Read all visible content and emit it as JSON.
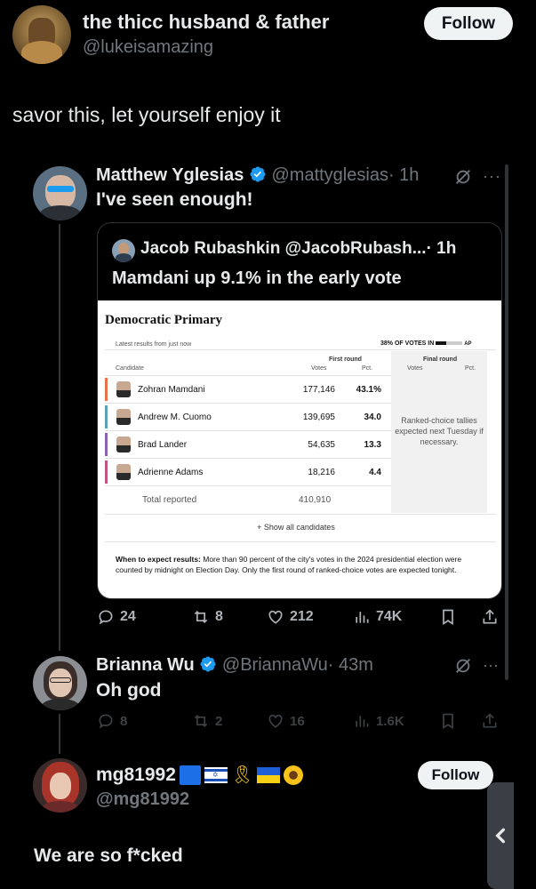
{
  "top_post": {
    "display_name": "the thicc husband & father",
    "handle": "@lukeisamazing",
    "follow_label": "Follow",
    "text": "savor this, let yourself enjoy it"
  },
  "reply1": {
    "display_name": "Matthew Yglesias",
    "handle": "@mattyglesias",
    "time": "· 1h",
    "text": "I've seen enough!",
    "quote": {
      "display_name": "Jacob Rubashkin",
      "handle": "@JacobRubash...",
      "time": "· 1h",
      "text": "Mamdani up 9.1% in the early vote"
    },
    "actions": {
      "replies": "24",
      "reposts": "8",
      "likes": "212",
      "views": "74K"
    }
  },
  "results": {
    "title": "Democratic Primary",
    "subtitle": "Latest results from just now",
    "votes_in": "38% OF VOTES IN",
    "ap": "AP",
    "first_round": "First round",
    "final_round": "Final round",
    "col_candidate": "Candidate",
    "col_votes": "Votes",
    "col_pct": "Pct.",
    "col_votes2": "Votes",
    "col_pct2": "Pct.",
    "rows": [
      {
        "name": "Zohran Mamdani",
        "votes": "177,146",
        "pct": "43.1%",
        "color": "#e8734a"
      },
      {
        "name": "Andrew M. Cuomo",
        "votes": "139,695",
        "pct": "34.0",
        "color": "#5aa3b4"
      },
      {
        "name": "Brad Lander",
        "votes": "54,635",
        "pct": "13.3",
        "color": "#8a63b8"
      },
      {
        "name": "Adrienne Adams",
        "votes": "18,216",
        "pct": "4.4",
        "color": "#c0567e"
      }
    ],
    "total_label": "Total reported",
    "total_votes": "410,910",
    "ranked_note": "Ranked-choice tallies expected next Tuesday if necessary.",
    "show_all": "+ Show all candidates",
    "expect_bold": "When to expect results:",
    "expect_text": " More than 90 percent of the city's votes in the 2024 presidential election were counted by midnight on Election Day. Only the first round of ranked-choice votes are expected tonight.",
    "progress_fraction": 0.38
  },
  "reply2": {
    "display_name": "Brianna Wu",
    "handle": "@BriannaWu",
    "time": "· 43m",
    "text": "Oh god",
    "actions": {
      "replies": "8",
      "reposts": "2",
      "likes": "16",
      "views": "1.6K"
    }
  },
  "reply3": {
    "display_name": "mg81992",
    "handle": "@mg81992",
    "follow_label": "Follow",
    "text": "We are so f*cked"
  },
  "colors": {
    "verified_blue": "#1d9bf0",
    "background": "#000000",
    "muted": "#71767b"
  }
}
